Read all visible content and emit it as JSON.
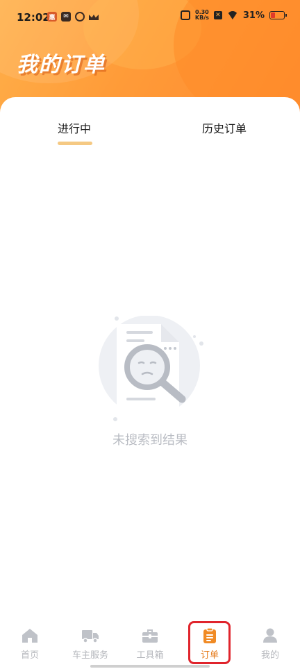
{
  "status_bar": {
    "time": "12:02",
    "net_speed_value": "0.30",
    "net_speed_unit": "KB/s",
    "battery_percent": "31%",
    "battery_level": 0.31
  },
  "header": {
    "title": "我的订单"
  },
  "tabs": [
    {
      "label": "进行中",
      "active": true
    },
    {
      "label": "历史订单",
      "active": false
    }
  ],
  "empty_state": {
    "message": "未搜索到结果",
    "icon": "document-search-icon"
  },
  "bottom_nav": {
    "items": [
      {
        "label": "首页",
        "icon": "home-icon",
        "active": false
      },
      {
        "label": "车主服务",
        "icon": "truck-icon",
        "active": false
      },
      {
        "label": "工具箱",
        "icon": "toolbox-icon",
        "active": false
      },
      {
        "label": "订单",
        "icon": "order-icon",
        "active": true
      },
      {
        "label": "我的",
        "icon": "profile-icon",
        "active": false
      }
    ]
  },
  "colors": {
    "accent": "#e57a1a",
    "header_gradient_start": "#ffb04a",
    "header_gradient_end": "#ff8a30",
    "tab_indicator": "#f5c983",
    "inactive": "#b6b8bd",
    "highlight_box": "#e0242c"
  }
}
